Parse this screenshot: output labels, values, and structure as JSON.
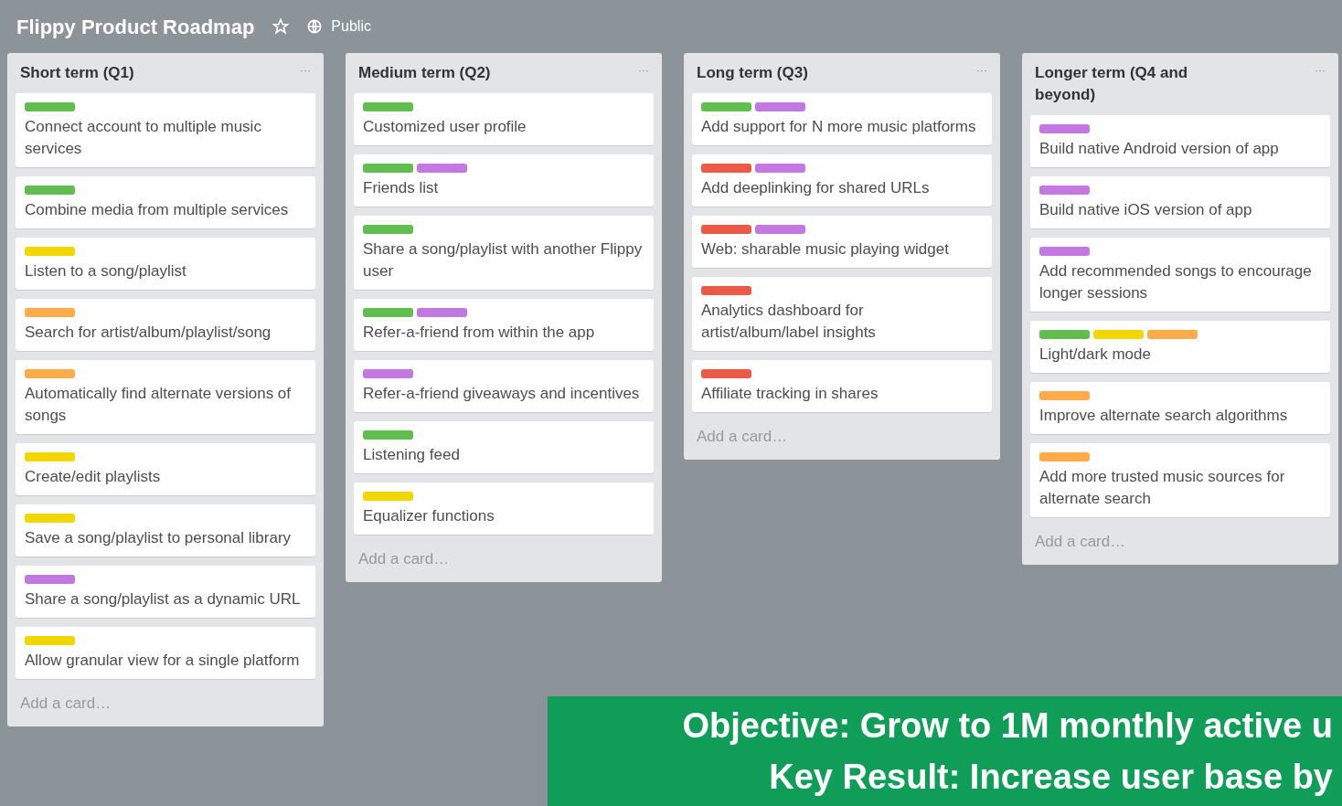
{
  "board": {
    "title": "Flippy Product Roadmap",
    "visibility": "Public"
  },
  "lists": [
    {
      "title": "Short term (Q1)",
      "menu": "···",
      "add_card": "Add a card…",
      "cards": [
        {
          "labels": [
            {
              "color": "#61bd4f"
            }
          ],
          "text": "Connect account to multiple music services"
        },
        {
          "labels": [
            {
              "color": "#61bd4f"
            }
          ],
          "text": "Combine media from multiple services"
        },
        {
          "labels": [
            {
              "color": "#f2d600"
            }
          ],
          "text": "Listen to a song/playlist"
        },
        {
          "labels": [
            {
              "color": "#ffab4a"
            }
          ],
          "text": "Search for artist/album/playlist/song"
        },
        {
          "labels": [
            {
              "color": "#ffab4a"
            }
          ],
          "text": "Automatically find alternate versions of songs"
        },
        {
          "labels": [
            {
              "color": "#f2d600"
            }
          ],
          "text": "Create/edit playlists"
        },
        {
          "labels": [
            {
              "color": "#f2d600"
            }
          ],
          "text": "Save a song/playlist to personal library"
        },
        {
          "labels": [
            {
              "color": "#c377e0"
            }
          ],
          "text": "Share a song/playlist as a dynamic URL"
        },
        {
          "labels": [
            {
              "color": "#f2d600"
            }
          ],
          "text": "Allow granular view for a single platform"
        }
      ]
    },
    {
      "title": "Medium term (Q2)",
      "menu": "···",
      "add_card": "Add a card…",
      "cards": [
        {
          "labels": [
            {
              "color": "#61bd4f"
            }
          ],
          "text": "Customized user profile"
        },
        {
          "labels": [
            {
              "color": "#61bd4f"
            },
            {
              "color": "#c377e0"
            }
          ],
          "text": "Friends list"
        },
        {
          "labels": [
            {
              "color": "#61bd4f"
            }
          ],
          "text": "Share a song/playlist with another Flippy user"
        },
        {
          "labels": [
            {
              "color": "#61bd4f"
            },
            {
              "color": "#c377e0"
            }
          ],
          "text": "Refer-a-friend from within the app"
        },
        {
          "labels": [
            {
              "color": "#c377e0"
            }
          ],
          "text": "Refer-a-friend giveaways and incentives"
        },
        {
          "labels": [
            {
              "color": "#61bd4f"
            }
          ],
          "text": "Listening feed"
        },
        {
          "labels": [
            {
              "color": "#f2d600"
            }
          ],
          "text": "Equalizer functions"
        }
      ]
    },
    {
      "title": "Long term (Q3)",
      "menu": "···",
      "add_card": "Add a card…",
      "cards": [
        {
          "labels": [
            {
              "color": "#61bd4f"
            },
            {
              "color": "#c377e0"
            }
          ],
          "text": "Add support for N more music platforms"
        },
        {
          "labels": [
            {
              "color": "#eb5a46"
            },
            {
              "color": "#c377e0"
            }
          ],
          "text": "Add deeplinking for shared URLs"
        },
        {
          "labels": [
            {
              "color": "#eb5a46"
            },
            {
              "color": "#c377e0"
            }
          ],
          "text": "Web: sharable music playing widget"
        },
        {
          "labels": [
            {
              "color": "#eb5a46"
            }
          ],
          "text": "Analytics dashboard for artist/album/label insights"
        },
        {
          "labels": [
            {
              "color": "#eb5a46"
            }
          ],
          "text": "Affiliate tracking in shares"
        }
      ]
    },
    {
      "title": "Longer term (Q4 and beyond)",
      "menu": "···",
      "add_card": "Add a card…",
      "cards": [
        {
          "labels": [
            {
              "color": "#c377e0"
            }
          ],
          "text": "Build native Android version of app"
        },
        {
          "labels": [
            {
              "color": "#c377e0"
            }
          ],
          "text": "Build native iOS version of app"
        },
        {
          "labels": [
            {
              "color": "#c377e0"
            }
          ],
          "text": "Add recommended songs to encourage longer sessions"
        },
        {
          "labels": [
            {
              "color": "#61bd4f"
            },
            {
              "color": "#f2d600"
            },
            {
              "color": "#ffab4a"
            }
          ],
          "text": "Light/dark mode"
        },
        {
          "labels": [
            {
              "color": "#ffab4a"
            }
          ],
          "text": "Improve alternate search algorithms"
        },
        {
          "labels": [
            {
              "color": "#ffab4a"
            }
          ],
          "text": "Add more trusted music sources for alternate search"
        }
      ]
    }
  ],
  "banner": {
    "lines": [
      "Objective: Grow to 1M monthly active u",
      "Key Result: Increase user base by"
    ]
  }
}
